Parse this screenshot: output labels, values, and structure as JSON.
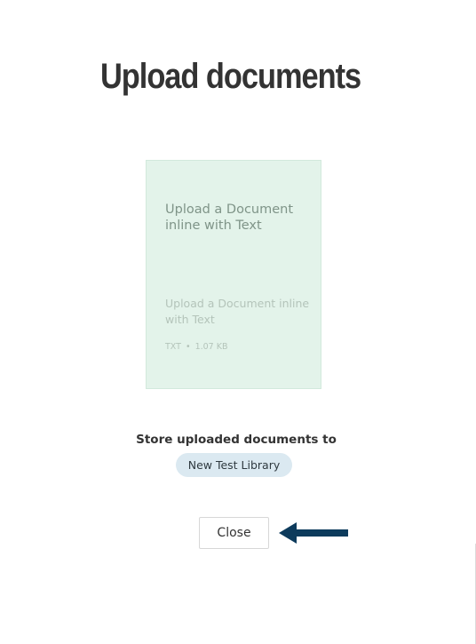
{
  "page": {
    "title": "Upload documents"
  },
  "document": {
    "heading": "Upload a Document inline with Text",
    "subtitle": "Upload a Document inline with Text",
    "type": "TXT",
    "separator": "•",
    "size": "1.07 KB"
  },
  "store": {
    "label": "Store uploaded documents to",
    "library": "New Test Library"
  },
  "actions": {
    "close_label": "Close"
  },
  "annotation": {
    "icon": "arrow-left-icon",
    "color": "#0d3b5c"
  },
  "colors": {
    "card_background": "#e3f3ea",
    "pill_background": "#dbe9f1"
  }
}
